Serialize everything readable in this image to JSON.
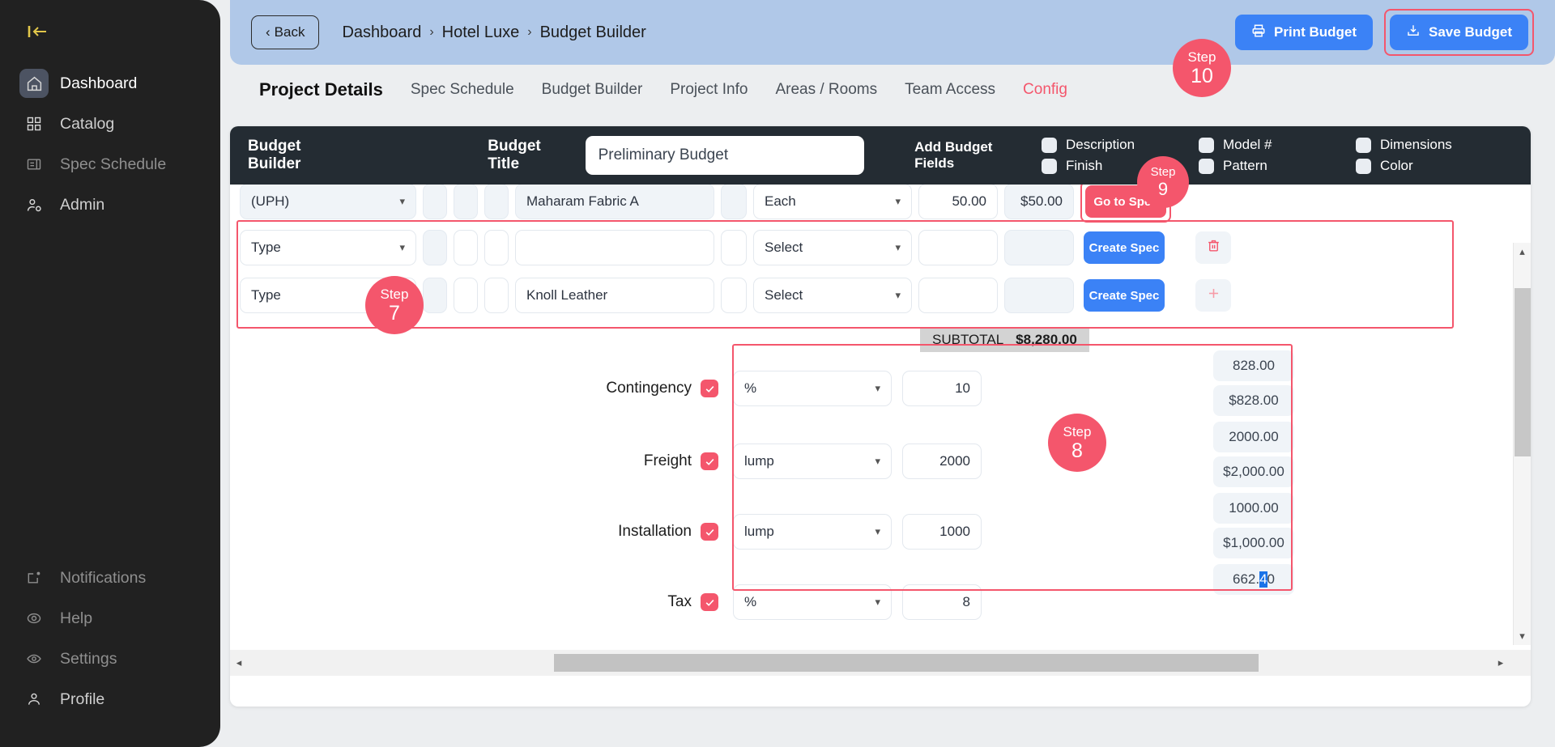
{
  "sidebar": {
    "collapse_icon": "collapse-panel-icon",
    "top_items": [
      {
        "label": "Dashboard",
        "icon": "home-icon",
        "state": "active"
      },
      {
        "label": "Catalog",
        "icon": "grid-icon",
        "state": "normal"
      },
      {
        "label": "Spec Schedule",
        "icon": "list-panel-icon",
        "state": "dim"
      },
      {
        "label": "Admin",
        "icon": "user-gear-icon",
        "state": "normal"
      }
    ],
    "bottom_items": [
      {
        "label": "Notifications",
        "icon": "bell-box-icon",
        "state": "dim"
      },
      {
        "label": "Help",
        "icon": "help-circle-icon",
        "state": "dim"
      },
      {
        "label": "Settings",
        "icon": "eye-settings-icon",
        "state": "dim"
      },
      {
        "label": "Profile",
        "icon": "user-icon",
        "state": "normal"
      }
    ]
  },
  "topbar": {
    "back_label": "Back",
    "back_icon": "chevron-left-icon",
    "breadcrumbs": [
      "Dashboard",
      "Hotel Luxe",
      "Budget Builder"
    ],
    "separator": "›",
    "print_label": "Print Budget",
    "print_icon": "printer-icon",
    "save_label": "Save Budget",
    "save_icon": "save-download-icon",
    "accent_blue": "#3b82f6",
    "header_bg": "#b0c8e8"
  },
  "tabs": [
    {
      "label": "Project Details",
      "style": "active-bold"
    },
    {
      "label": "Spec Schedule",
      "style": "normal"
    },
    {
      "label": "Budget Builder",
      "style": "normal"
    },
    {
      "label": "Project Info",
      "style": "normal"
    },
    {
      "label": "Areas / Rooms",
      "style": "normal"
    },
    {
      "label": "Team Access",
      "style": "normal"
    },
    {
      "label": "Config",
      "style": "config"
    }
  ],
  "budget_header": {
    "title": "Budget Builder",
    "budget_title_label": "Budget Title",
    "budget_title_value": "Preliminary Budget",
    "add_fields_label": "Add Budget Fields",
    "fields": [
      {
        "label": "Description",
        "checked": false
      },
      {
        "label": "Model #",
        "checked": false
      },
      {
        "label": "Dimensions",
        "checked": false
      },
      {
        "label": "Finish",
        "checked": false
      },
      {
        "label": "Pattern",
        "checked": false
      },
      {
        "label": "Color",
        "checked": false
      }
    ]
  },
  "rows": [
    {
      "type": "(UPH)",
      "name": "Maharam Fabric A",
      "unit": "Each",
      "qty": "50.00",
      "total": "$50.00",
      "action": "Go to Spec",
      "action_style": "red",
      "trailing_icon": "",
      "filled": true
    },
    {
      "type": "Type",
      "name": "",
      "unit": "Select",
      "qty": "",
      "total": "",
      "action": "Create Spec",
      "action_style": "blue",
      "trailing_icon": "trash-icon",
      "filled": false
    },
    {
      "type": "Type",
      "name": "Knoll Leather",
      "unit": "Select",
      "qty": "",
      "total": "",
      "action": "Create Spec",
      "action_style": "blue",
      "trailing_icon": "plus-icon",
      "filled": false
    }
  ],
  "subtotal": {
    "label": "SUBTOTAL",
    "value": "$8,280.00"
  },
  "summary": [
    {
      "label": "Contingency",
      "checked": true,
      "mode": "%",
      "value": "10",
      "calc_raw": "828.00",
      "calc_fmt": "$828.00"
    },
    {
      "label": "Freight",
      "checked": true,
      "mode": "lump",
      "value": "2000",
      "calc_raw": "2000.00",
      "calc_fmt": "$2,000.00"
    },
    {
      "label": "Installation",
      "checked": true,
      "mode": "lump",
      "value": "1000",
      "calc_raw": "1000.00",
      "calc_fmt": "$1,000.00"
    },
    {
      "label": "Tax",
      "checked": true,
      "mode": "%",
      "value": "8",
      "calc_raw": "662.40",
      "calc_raw_pre": "662.",
      "calc_raw_sel": "4",
      "calc_raw_post": "0",
      "calc_fmt": ""
    }
  ],
  "steps": [
    {
      "word": "Step",
      "num": "7"
    },
    {
      "word": "Step",
      "num": "8"
    },
    {
      "word": "Step",
      "num": "9"
    },
    {
      "word": "Step",
      "num": "10"
    }
  ],
  "scroll": {
    "up_icon": "chevron-up-icon",
    "down_icon": "chevron-down-icon",
    "left_icon": "chevron-left-icon",
    "right_icon": "chevron-right-icon"
  },
  "colors": {
    "accent_red": "#f4566c",
    "accent_blue": "#3b82f6",
    "dark": "#242c33"
  }
}
